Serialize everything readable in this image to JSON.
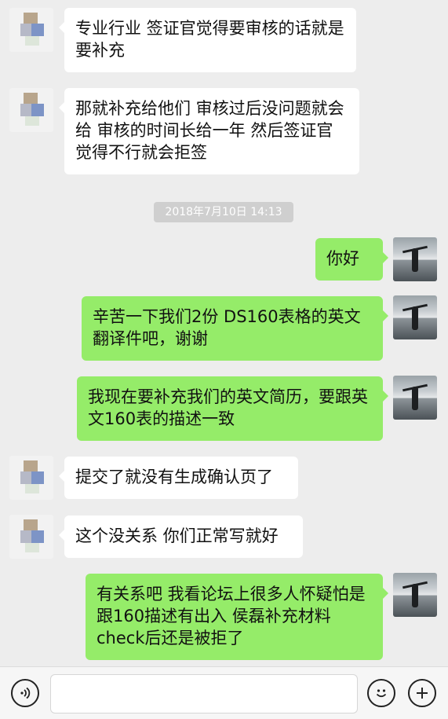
{
  "messages": [
    {
      "side": "left",
      "text": "专业行业 签证官觉得要审核的话就是要补充"
    },
    {
      "side": "left",
      "text": "那就补充给他们 审核过后没问题就会给 审核的时间长给一年 然后签证官觉得不行就会拒签"
    },
    {
      "side": "right",
      "text": "你好"
    },
    {
      "side": "right",
      "text": "辛苦一下我们2份 DS160表格的英文翻译件吧，谢谢"
    },
    {
      "side": "right",
      "text": "我现在要补充我们的英文简历，要跟英文160表的描述一致"
    },
    {
      "side": "left",
      "text": "提交了就没有生成确认页了"
    },
    {
      "side": "left",
      "text": "这个没关系 你们正常写就好"
    },
    {
      "side": "right",
      "text": "有关系吧  我看论坛上很多人怀疑怕是跟160描述有出入  侯磊补充材料check后还是被拒了"
    }
  ],
  "timestamp": "2018年7月10日 14:13",
  "input_bar": {
    "voice_icon": "voice-icon",
    "emoji_icon": "emoji-icon",
    "plus_icon": "plus-icon",
    "message_value": ""
  },
  "colors": {
    "background": "#ededed",
    "bubble_left": "#ffffff",
    "bubble_right": "#95ec69",
    "timestamp_bg": "#cfcfcf"
  }
}
